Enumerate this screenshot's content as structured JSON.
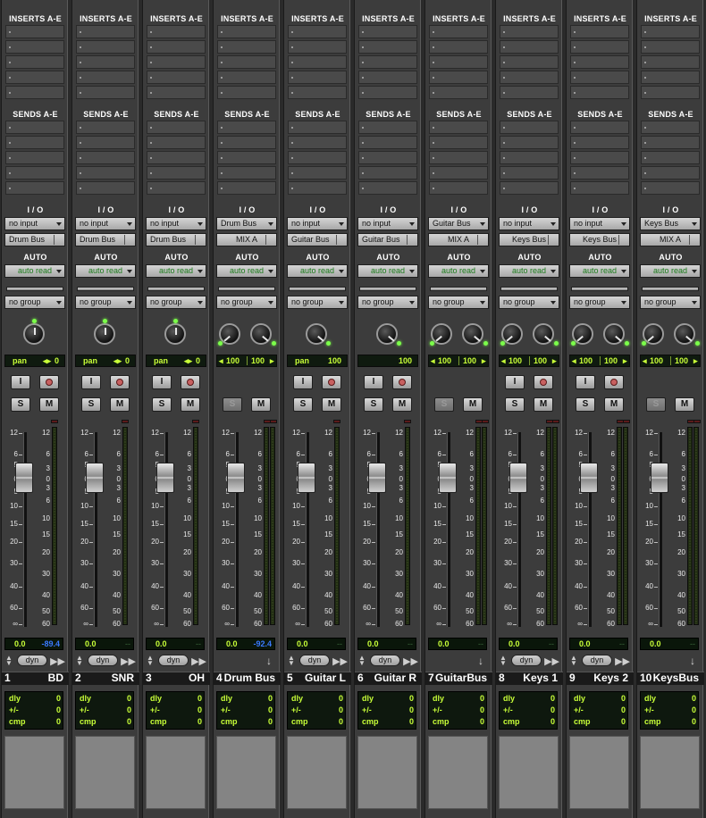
{
  "labels": {
    "inserts": "INSERTS A-E",
    "sends": "SENDS A-E",
    "io": "I / O",
    "auto": "AUTO",
    "input_btn": "I",
    "solo_btn": "S",
    "mute_btn": "M",
    "dyn": "dyn",
    "dly": "dly",
    "plusminus": "+/-",
    "cmp": "cmp"
  },
  "fader_scale": [
    "12",
    "6",
    "5",
    "0",
    "5",
    "10",
    "15",
    "20",
    "30",
    "40",
    "60",
    "∞"
  ],
  "meter_scale": [
    "12",
    "6",
    "3",
    "0",
    "3",
    "6",
    "10",
    "15",
    "20",
    "30",
    "40",
    "50",
    "60"
  ],
  "colors": {
    "strip_bg": "#3c3c3c",
    "lcd_text": "#c8ff38",
    "peak_blue": "#3a7aff",
    "auto_green": "#1a7a1a",
    "led_green": "#7cff4a"
  },
  "tracks": [
    {
      "num": "1",
      "name": "BD",
      "input": "no input",
      "output": "Drum Bus",
      "auto": "auto read",
      "group": "no group",
      "stereo": false,
      "pan_label": "pan",
      "pan_value": "0",
      "rec": true,
      "solo_enabled": true,
      "volume": "0.0",
      "peak": "-89.4",
      "dyn": true,
      "dly": "0",
      "plusminus": "0",
      "cmp": "0"
    },
    {
      "num": "2",
      "name": "SNR",
      "input": "no input",
      "output": "Drum Bus",
      "auto": "auto read",
      "group": "no group",
      "stereo": false,
      "pan_label": "pan",
      "pan_value": "0",
      "rec": true,
      "solo_enabled": true,
      "volume": "0.0",
      "peak": "",
      "dyn": true,
      "dly": "0",
      "plusminus": "0",
      "cmp": "0"
    },
    {
      "num": "3",
      "name": "OH",
      "input": "no input",
      "output": "Drum Bus",
      "auto": "auto read",
      "group": "no group",
      "stereo": false,
      "pan_label": "pan",
      "pan_value": "0",
      "rec": true,
      "solo_enabled": true,
      "volume": "0.0",
      "peak": "",
      "dyn": true,
      "dly": "0",
      "plusminus": "0",
      "cmp": "0"
    },
    {
      "num": "4",
      "name": "Drum Bus",
      "input": "Drum Bus",
      "output": "MIX A",
      "auto": "auto read",
      "group": "no group",
      "stereo": true,
      "pan_left": "100",
      "pan_right": "100",
      "rec": false,
      "solo_enabled": false,
      "volume": "0.0",
      "peak": "-92.4",
      "dyn": false,
      "dly": "0",
      "plusminus": "0",
      "cmp": "0"
    },
    {
      "num": "5",
      "name": "Guitar L",
      "input": "no input",
      "output": "Guitar Bus",
      "auto": "auto read",
      "group": "no group",
      "stereo": false,
      "pan_label": "pan",
      "pan_value": "100",
      "rec": true,
      "solo_enabled": true,
      "volume": "0.0",
      "peak": "",
      "dyn": true,
      "dly": "0",
      "plusminus": "0",
      "cmp": "0"
    },
    {
      "num": "6",
      "name": "Guitar R",
      "input": "no input",
      "output": "Guitar Bus",
      "auto": "auto read",
      "group": "no group",
      "stereo": false,
      "pan_label": "",
      "pan_value": "100",
      "rec": true,
      "solo_enabled": true,
      "volume": "0.0",
      "peak": "",
      "dyn": true,
      "dly": "0",
      "plusminus": "0",
      "cmp": "0"
    },
    {
      "num": "7",
      "name": "GuitarBus",
      "input": "Guitar Bus",
      "output": "MIX A",
      "auto": "auto read",
      "group": "no group",
      "stereo": true,
      "pan_left": "100",
      "pan_right": "100",
      "rec": false,
      "solo_enabled": false,
      "volume": "0.0",
      "peak": "",
      "dyn": false,
      "dly": "0",
      "plusminus": "0",
      "cmp": "0"
    },
    {
      "num": "8",
      "name": "Keys 1",
      "input": "no input",
      "output": "Keys Bus",
      "auto": "auto read",
      "group": "no group",
      "stereo": true,
      "pan_left": "100",
      "pan_right": "100",
      "rec": true,
      "solo_enabled": true,
      "volume": "0.0",
      "peak": "",
      "dyn": true,
      "dly": "0",
      "plusminus": "0",
      "cmp": "0"
    },
    {
      "num": "9",
      "name": "Keys 2",
      "input": "no input",
      "output": "Keys Bus",
      "auto": "auto read",
      "group": "no group",
      "stereo": true,
      "pan_left": "100",
      "pan_right": "100",
      "rec": true,
      "solo_enabled": true,
      "volume": "0.0",
      "peak": "",
      "dyn": true,
      "dly": "0",
      "plusminus": "0",
      "cmp": "0"
    },
    {
      "num": "10",
      "name": "KeysBus",
      "input": "Keys Bus",
      "output": "MIX A",
      "auto": "auto read",
      "group": "no group",
      "stereo": true,
      "pan_left": "100",
      "pan_right": "100",
      "rec": false,
      "solo_enabled": false,
      "volume": "0.0",
      "peak": "",
      "dyn": false,
      "dly": "0",
      "plusminus": "0",
      "cmp": "0"
    }
  ]
}
